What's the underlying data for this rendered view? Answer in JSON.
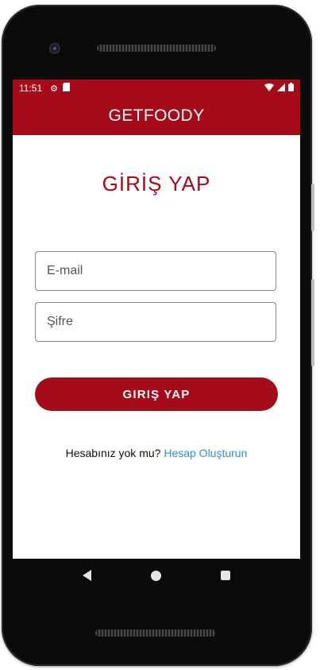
{
  "status_bar": {
    "time": "11:51",
    "icons": [
      "settings-icon",
      "sd-card-icon",
      "wifi-icon",
      "signal-icon",
      "battery-icon"
    ]
  },
  "app_bar": {
    "title": "GETFOODY"
  },
  "login": {
    "title": "GİRİŞ YAP",
    "email_placeholder": "E-mail",
    "password_placeholder": "Şifre",
    "login_button": "GIRIŞ YAP"
  },
  "signup": {
    "prompt": "Hesabınız yok mu?",
    "link": "Hesap Oluşturun"
  },
  "nav_bar": {
    "icons": [
      "back-icon",
      "home-icon",
      "recents-icon"
    ]
  },
  "colors": {
    "primary": "#a50b19",
    "link": "#2f8fd6"
  }
}
